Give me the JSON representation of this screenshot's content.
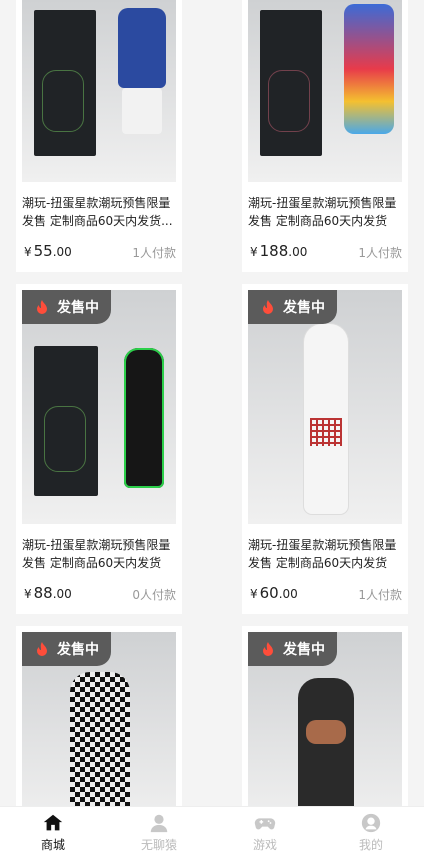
{
  "products": [
    {
      "badge": "",
      "title": "潮玩-扭蛋星款潮玩预售限量发售 定制商品60天内发货...",
      "currency": "¥",
      "price_int": "55",
      "price_dec": ".00",
      "paid": "1人付款",
      "toy_color": "#2b4aa0"
    },
    {
      "badge": "",
      "title": "潮玩-扭蛋星款潮玩预售限量发售 定制商品60天内发货(...",
      "currency": "¥",
      "price_int": "188",
      "price_dec": ".00",
      "paid": "1人付款",
      "toy_color": "#e83b4a"
    },
    {
      "badge": "发售中",
      "title": "潮玩-扭蛋星款潮玩预售限量发售 定制商品60天内发货(...",
      "currency": "¥",
      "price_int": "88",
      "price_dec": ".00",
      "paid": "0人付款",
      "toy_color": "#1a1a1a"
    },
    {
      "badge": "发售中",
      "title": "潮玩-扭蛋星款潮玩预售限量发售 定制商品60天内发货(...",
      "currency": "¥",
      "price_int": "60",
      "price_dec": ".00",
      "paid": "1人付款",
      "toy_color": "#f5f5f5"
    },
    {
      "badge": "发售中",
      "title": "",
      "currency": "",
      "price_int": "",
      "price_dec": "",
      "paid": "",
      "toy_color": "#e6e6e6"
    },
    {
      "badge": "发售中",
      "title": "",
      "currency": "",
      "price_int": "",
      "price_dec": "",
      "paid": "",
      "toy_color": "#2a2a2a"
    }
  ],
  "tabs": [
    {
      "label": "商城",
      "icon": "home-icon",
      "active": true
    },
    {
      "label": "无聊猿",
      "icon": "person-icon",
      "active": false
    },
    {
      "label": "游戏",
      "icon": "gamepad-icon",
      "active": false
    },
    {
      "label": "我的",
      "icon": "profile-icon",
      "active": false
    }
  ]
}
